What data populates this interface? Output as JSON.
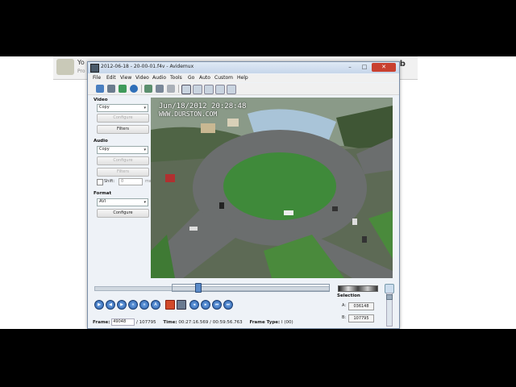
{
  "background_window": {
    "text_line1": "Yo",
    "text_line2": "Pro",
    "logo_text": "erb"
  },
  "window": {
    "title": "2012-06-18 - 20-00-01.f4v - Avidemux",
    "controls": {
      "minimize": "–",
      "maximize": "□",
      "close": "✕"
    }
  },
  "menu": [
    "File",
    "Edit",
    "View",
    "Video",
    "Audio",
    "Tools",
    "Go",
    "Auto",
    "Custom",
    "Help"
  ],
  "sidebar": {
    "video": {
      "title": "Video",
      "codec": "Copy",
      "configure": "Configure",
      "filters": "Filters"
    },
    "audio": {
      "title": "Audio",
      "codec": "Copy",
      "configure": "Configure",
      "filters": "Filters",
      "shift_label": "Shift:",
      "shift_value": "0",
      "shift_unit": "ms"
    },
    "format": {
      "title": "Format",
      "container": "AVI",
      "configure": "Configure"
    }
  },
  "video_osd": {
    "line1": "Jun/18/2012 20:28:48",
    "line2": "WWW.DURSTON.COM"
  },
  "playback": {
    "position_fraction": 0.44
  },
  "selection": {
    "title": "Selection",
    "a_label": "A:",
    "a_value": "036148",
    "b_label": "B:",
    "b_value": "107795"
  },
  "status": {
    "frame_label": "Frame:",
    "frame_value": "49048",
    "frame_total": "/ 107795",
    "time_label": "Time:",
    "time_value": "00:27:16.569",
    "time_total": "/ 00:59:56.763",
    "frame_type_label": "Frame Type:",
    "frame_type_value": "I (00)"
  },
  "colors": {
    "accent_blue": "#2a5ea8",
    "close_red": "#c84030",
    "record_red": "#d24a2a"
  }
}
